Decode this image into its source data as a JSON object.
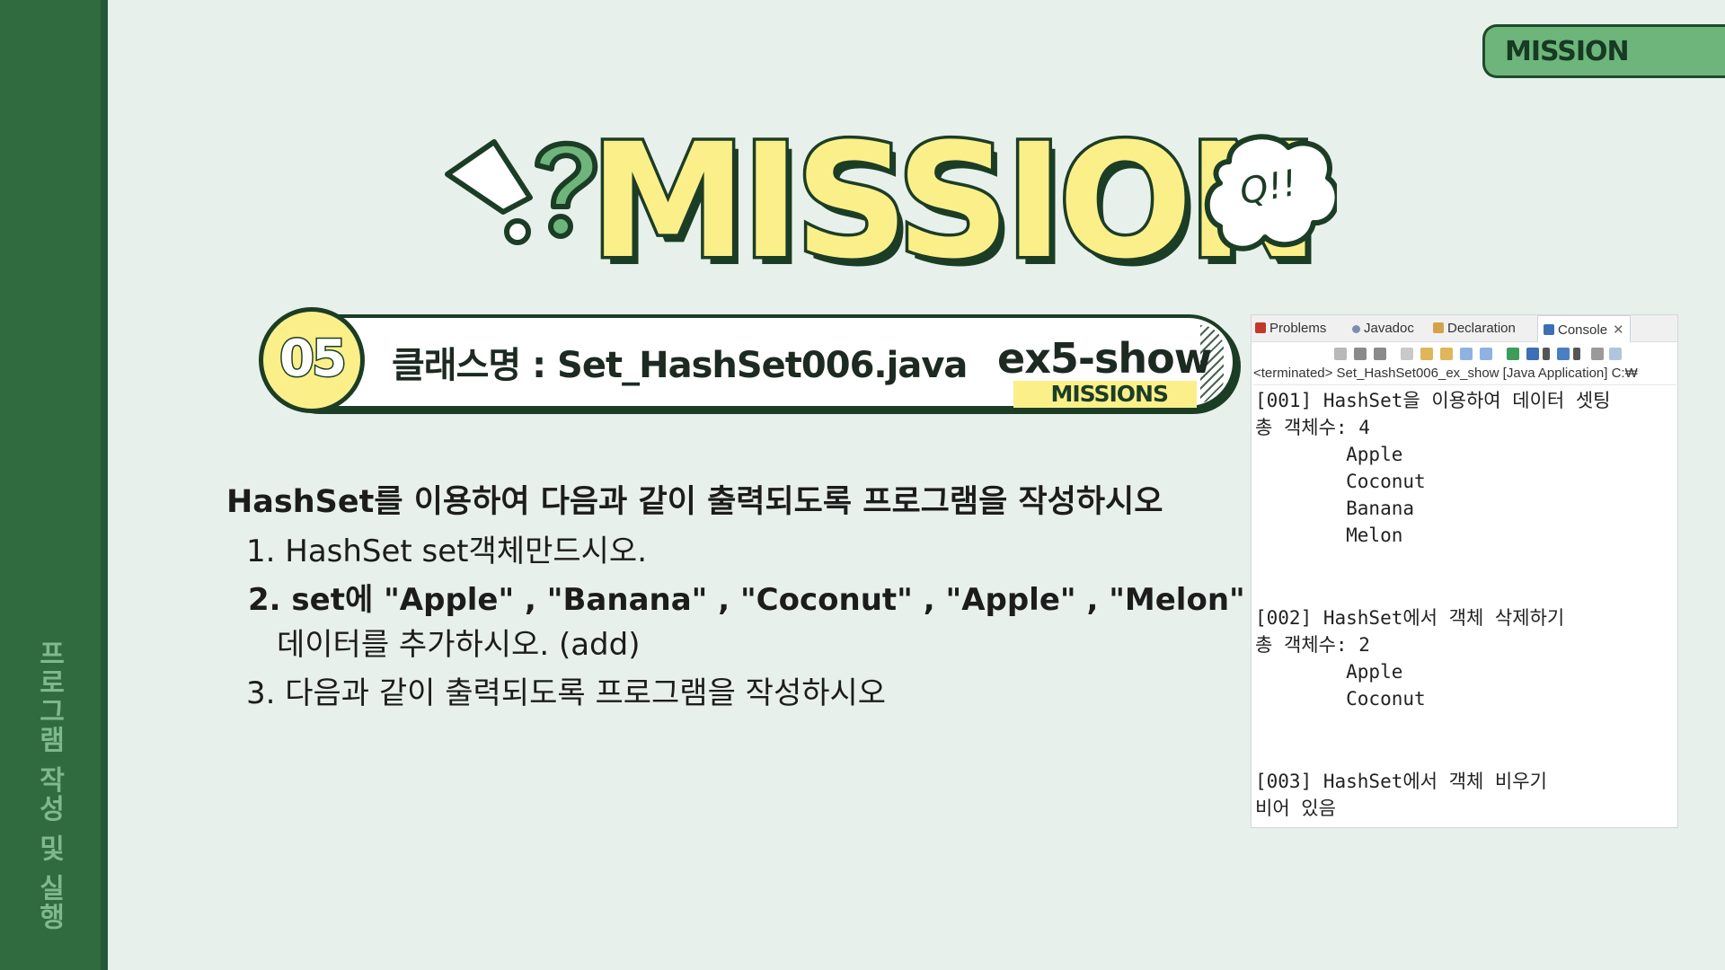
{
  "sidebar": {
    "vertical_text": "프로그램 작성 및 실행"
  },
  "top_tab": {
    "label": "MISSION"
  },
  "hero": {
    "title": "MISSION",
    "bubble": "Q!!"
  },
  "header": {
    "number": "05",
    "class_label": "클래스명 : Set_HashSet006.java",
    "example": "ex5-show",
    "tag": "MISSIONS"
  },
  "instructions": {
    "heading": "HashSet를 이용하여 다음과 같이 출력되도록 프로그램을 작성하시오",
    "lines": [
      "1.  HashSet   set객체만드시오.",
      "2. set에   \"Apple\" , \"Banana\" , \"Coconut\" , \"Apple\" , \"Melon\"",
      "데이터를  추가하시오. (add)",
      "3.  다음과 같이 출력되도록 프로그램을 작성하시오"
    ]
  },
  "console": {
    "tabs": [
      "Problems",
      "Javadoc",
      "Declaration",
      "Console"
    ],
    "terminated": "<terminated> Set_HashSet006_ex_show [Java Application] C:₩",
    "output": [
      "[001] HashSet을 이용하여 데이터 셋팅",
      "총 객체수: 4",
      "        Apple",
      "        Coconut",
      "        Banana",
      "        Melon",
      "",
      "",
      "[002] HashSet에서 객체 삭제하기",
      "총 객체수: 2",
      "        Apple",
      "        Coconut",
      "",
      "",
      "[003] HashSet에서 객체 비우기",
      "비어 있음"
    ]
  },
  "colors": {
    "sidebar": "#2f6b3f",
    "accent_green": "#6eb57c",
    "yellow": "#fbef8a",
    "outline": "#1c3d25",
    "background": "#e8f0eb"
  }
}
